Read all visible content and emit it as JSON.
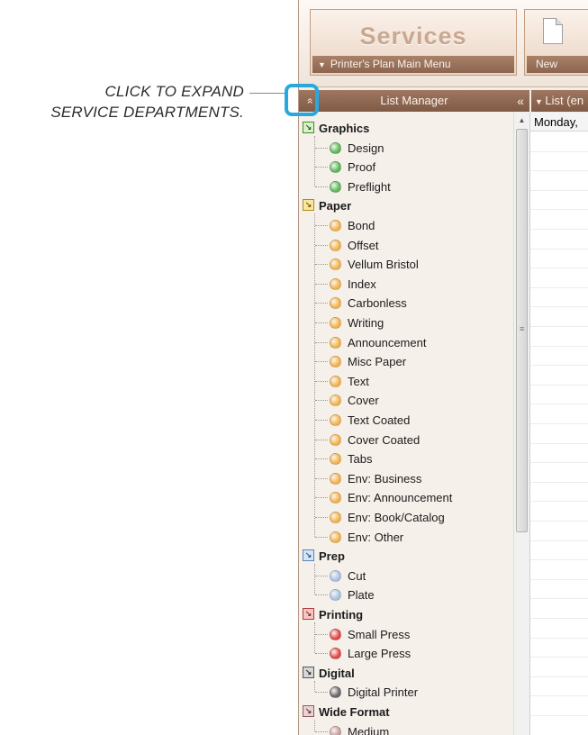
{
  "annotation": {
    "line1": "CLICK TO EXPAND",
    "line2": "SERVICE DEPARTMENTS."
  },
  "toolbar": {
    "services_title": "Services",
    "main_menu_label": "Printer's Plan Main Menu",
    "new_label": "New"
  },
  "list_manager": {
    "expand_glyph": "»",
    "title": "List Manager",
    "collapse_glyph": "«",
    "list_header": "List (en",
    "day_label": "Monday,"
  },
  "colors": {
    "Graphics": "#5fba5c",
    "Paper": "#f3b450",
    "Prep": "#a9c4e2",
    "Printing": "#e04a4a",
    "Digital": "#6b6b6b",
    "Wide Format": "#c7a0a0"
  },
  "tree": [
    {
      "name": "Graphics",
      "items": [
        "Design",
        "Proof",
        "Preflight"
      ]
    },
    {
      "name": "Paper",
      "items": [
        "Bond",
        "Offset",
        "Vellum Bristol",
        "Index",
        "Carbonless",
        "Writing",
        "Announcement",
        "Misc Paper",
        "Text",
        "Cover",
        "Text Coated",
        "Cover Coated",
        "Tabs",
        "Env: Business",
        "Env: Announcement",
        "Env: Book/Catalog",
        "Env: Other"
      ]
    },
    {
      "name": "Prep",
      "items": [
        "Cut",
        "Plate"
      ]
    },
    {
      "name": "Printing",
      "items": [
        "Small Press",
        "Large Press"
      ]
    },
    {
      "name": "Digital",
      "items": [
        "Digital Printer"
      ]
    },
    {
      "name": "Wide Format",
      "items": [
        "Medium"
      ]
    }
  ]
}
